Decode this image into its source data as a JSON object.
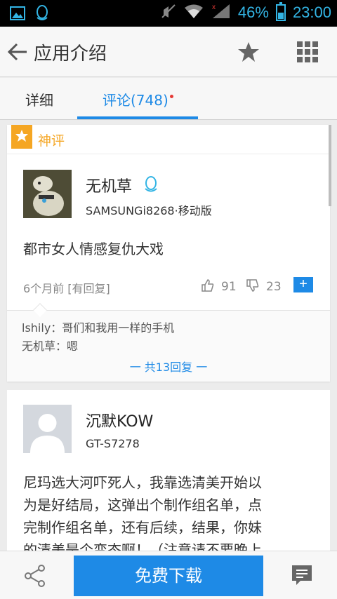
{
  "status_bar": {
    "battery": "46%",
    "time": "23:00"
  },
  "header": {
    "title": "应用介绍"
  },
  "tabs": [
    {
      "label": "详细"
    },
    {
      "label": "评论(748)"
    }
  ],
  "featured": {
    "badge": "神评",
    "username": "无机草",
    "device": "SAMSUNGi8268·移动版",
    "text": "都市女人情感复仇大戏",
    "meta": "6个月前 [有回复]",
    "likes": "91",
    "dislikes": "23",
    "replies": [
      "lshily：哥们和我用一样的手机",
      "无机草：嗯"
    ],
    "more_replies": "一 共13回复 一"
  },
  "second": {
    "username": "沉默KOW",
    "device": "GT-S7278",
    "lines": [
      "尼玛选大河吓死人，我靠选清美开始以",
      "为是好结局，这弹出个制作组名单，点",
      "完制作组名单，还有后续，结果，你妹",
      "的清美是个变态啊！（注意请不要晚上"
    ]
  },
  "bottom": {
    "download": "免费下载"
  },
  "colors": {
    "accent": "#1e8ae6",
    "badge": "#f5a623",
    "status": "#33b5e5"
  }
}
